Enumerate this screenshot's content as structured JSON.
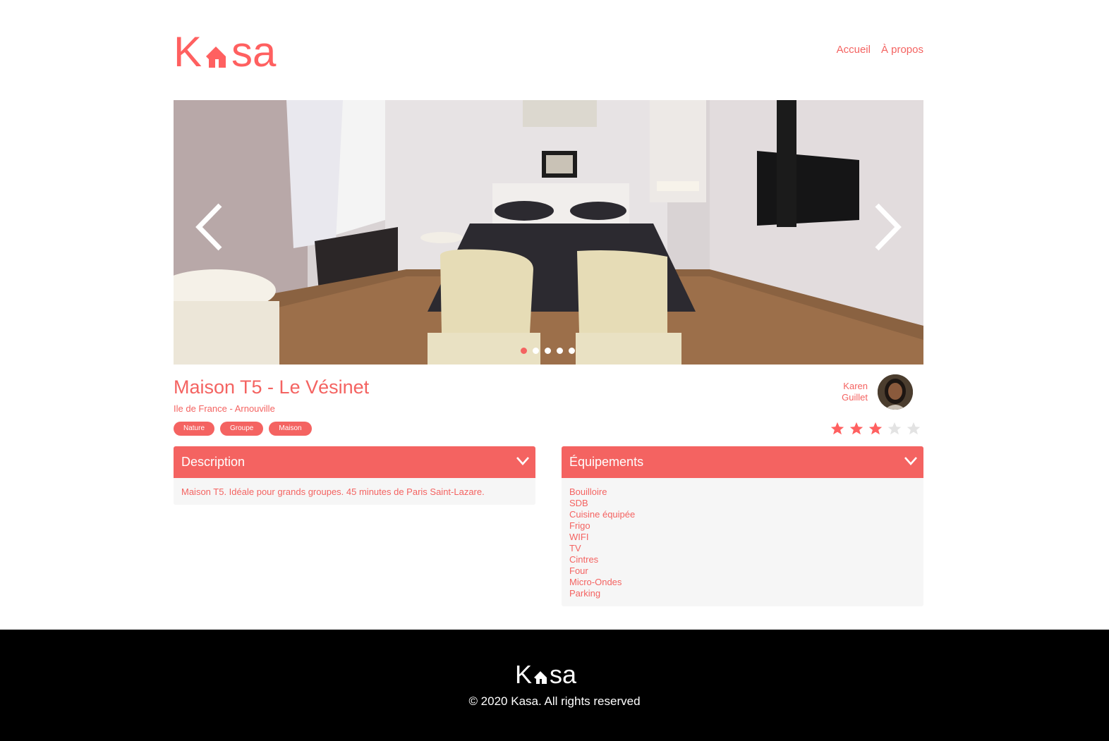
{
  "brand": {
    "name": "Kasa",
    "accent_color": "#FF6060"
  },
  "nav": {
    "items": [
      {
        "label": "Accueil"
      },
      {
        "label": "À propos"
      }
    ]
  },
  "carousel": {
    "slide_count": 5,
    "active_slide": 1,
    "prev_icon": "chevron-left-icon",
    "next_icon": "chevron-right-icon"
  },
  "listing": {
    "title": "Maison T5 - Le Vésinet",
    "location": "Ile de France - Arnouville",
    "tags": [
      "Nature",
      "Groupe",
      "Maison"
    ],
    "host": {
      "first_name": "Karen",
      "last_name": "Guillet"
    },
    "rating": 3,
    "rating_max": 5
  },
  "description": {
    "title": "Description",
    "text": "Maison T5. Idéale pour grands groupes. 45 minutes de Paris Saint-Lazare."
  },
  "equipments": {
    "title": "Équipements",
    "items": [
      "Bouilloire",
      "SDB",
      "Cuisine équipée",
      "Frigo",
      "WIFI",
      "TV",
      "Cintres",
      "Four",
      "Micro-Ondes",
      "Parking"
    ]
  },
  "footer": {
    "copyright": "© 2020 Kasa. All rights reserved"
  }
}
